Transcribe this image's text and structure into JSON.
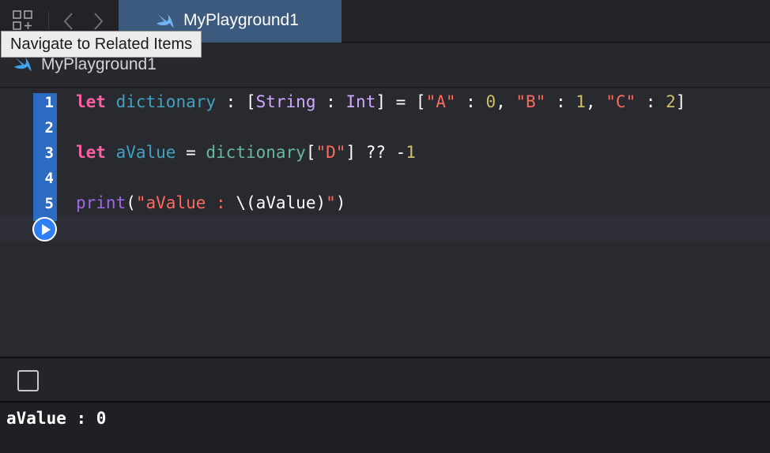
{
  "toolbar": {
    "related_items_icon": "related-items-grid-icon",
    "back_icon": "chevron-left-icon",
    "forward_icon": "chevron-right-icon",
    "tooltip": "Navigate to Related Items"
  },
  "tab": {
    "title": "MyPlayground1",
    "icon": "swift-icon",
    "color": "#3b5a7e"
  },
  "jumpbar": {
    "label": "MyPlayground1",
    "icon": "swift-icon"
  },
  "editor": {
    "line_numbers": [
      "1",
      "2",
      "3",
      "4",
      "5"
    ],
    "lines": [
      [
        {
          "t": "let",
          "c": "kw"
        },
        {
          "t": " ",
          "c": "pl"
        },
        {
          "t": "dictionary",
          "c": "decl"
        },
        {
          "t": " : [",
          "c": "pl"
        },
        {
          "t": "String",
          "c": "ty"
        },
        {
          "t": " : ",
          "c": "pl"
        },
        {
          "t": "Int",
          "c": "ty"
        },
        {
          "t": "] = [",
          "c": "pl"
        },
        {
          "t": "\"A\"",
          "c": "str"
        },
        {
          "t": " : ",
          "c": "pl"
        },
        {
          "t": "0",
          "c": "num"
        },
        {
          "t": ", ",
          "c": "pl"
        },
        {
          "t": "\"B\"",
          "c": "str"
        },
        {
          "t": " : ",
          "c": "pl"
        },
        {
          "t": "1",
          "c": "num"
        },
        {
          "t": ", ",
          "c": "pl"
        },
        {
          "t": "\"C\"",
          "c": "str"
        },
        {
          "t": " : ",
          "c": "pl"
        },
        {
          "t": "2",
          "c": "num"
        },
        {
          "t": "]",
          "c": "pl"
        }
      ],
      [],
      [
        {
          "t": "let",
          "c": "kw"
        },
        {
          "t": " ",
          "c": "pl"
        },
        {
          "t": "aValue",
          "c": "decl"
        },
        {
          "t": " = ",
          "c": "pl"
        },
        {
          "t": "dictionary",
          "c": "var"
        },
        {
          "t": "[",
          "c": "pl"
        },
        {
          "t": "\"D\"",
          "c": "str"
        },
        {
          "t": "] ?? -",
          "c": "pl"
        },
        {
          "t": "1",
          "c": "num"
        }
      ],
      [],
      [
        {
          "t": "print",
          "c": "fn"
        },
        {
          "t": "(",
          "c": "pl"
        },
        {
          "t": "\"aValue : ",
          "c": "str"
        },
        {
          "t": "\\(",
          "c": "pl"
        },
        {
          "t": "aValue",
          "c": "pl"
        },
        {
          "t": ")",
          "c": "pl"
        },
        {
          "t": "\"",
          "c": "str"
        },
        {
          "t": ")",
          "c": "pl"
        }
      ]
    ],
    "run_icon": "play-icon",
    "gutter_color": "#2d6bc2"
  },
  "debug": {
    "toggle_icon": "square-toggle-icon"
  },
  "console": {
    "output": "aValue : 0"
  }
}
